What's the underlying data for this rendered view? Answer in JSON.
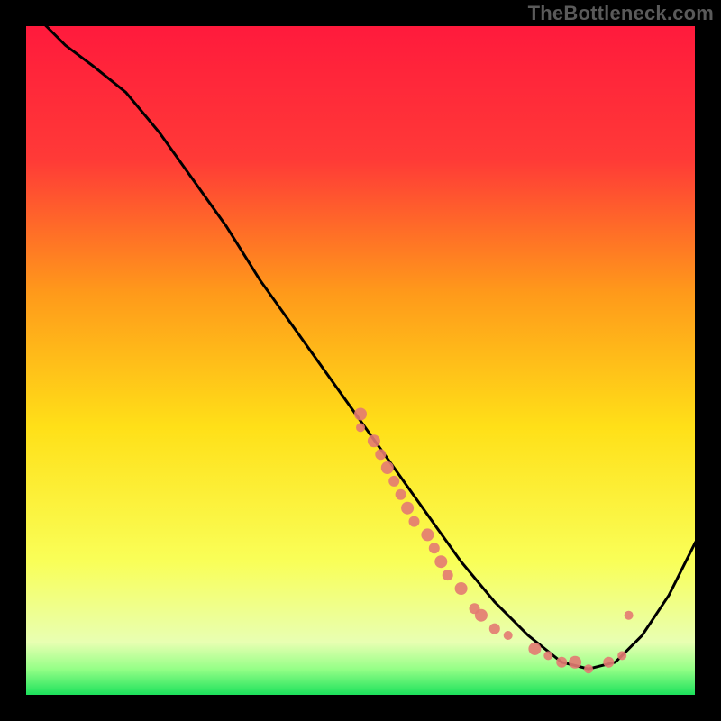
{
  "watermark": "TheBottleneck.com",
  "chart_data": {
    "type": "line",
    "title": "",
    "xlabel": "",
    "ylabel": "",
    "xlim": [
      0,
      100
    ],
    "ylim": [
      0,
      100
    ],
    "background_gradient": {
      "direction": "vertical",
      "stops": [
        {
          "t": 0.0,
          "color": "#ff1a3c"
        },
        {
          "t": 0.2,
          "color": "#ff3a37"
        },
        {
          "t": 0.4,
          "color": "#ff9a1a"
        },
        {
          "t": 0.6,
          "color": "#ffe018"
        },
        {
          "t": 0.8,
          "color": "#f9ff58"
        },
        {
          "t": 0.92,
          "color": "#e8ffb2"
        },
        {
          "t": 0.96,
          "color": "#95ff87"
        },
        {
          "t": 1.0,
          "color": "#18e05a"
        }
      ]
    },
    "series": [
      {
        "name": "bottleneck-curve",
        "type": "line",
        "color": "#000000",
        "width": 3,
        "x": [
          3,
          6,
          10,
          15,
          20,
          25,
          30,
          35,
          40,
          45,
          50,
          55,
          60,
          65,
          70,
          75,
          80,
          84,
          88,
          92,
          96,
          100
        ],
        "y": [
          100,
          97,
          94,
          90,
          84,
          77,
          70,
          62,
          55,
          48,
          41,
          34,
          27,
          20,
          14,
          9,
          5,
          4,
          5,
          9,
          15,
          23
        ]
      },
      {
        "name": "sample-points",
        "type": "scatter",
        "color": "#e37a72",
        "radius_small": 4,
        "radius_large": 7,
        "points": [
          {
            "x": 50,
            "y": 42,
            "r": 7
          },
          {
            "x": 50,
            "y": 40,
            "r": 5
          },
          {
            "x": 52,
            "y": 38,
            "r": 7
          },
          {
            "x": 53,
            "y": 36,
            "r": 6
          },
          {
            "x": 54,
            "y": 34,
            "r": 7
          },
          {
            "x": 55,
            "y": 32,
            "r": 6
          },
          {
            "x": 56,
            "y": 30,
            "r": 6
          },
          {
            "x": 57,
            "y": 28,
            "r": 7
          },
          {
            "x": 58,
            "y": 26,
            "r": 6
          },
          {
            "x": 60,
            "y": 24,
            "r": 7
          },
          {
            "x": 61,
            "y": 22,
            "r": 6
          },
          {
            "x": 62,
            "y": 20,
            "r": 7
          },
          {
            "x": 63,
            "y": 18,
            "r": 6
          },
          {
            "x": 65,
            "y": 16,
            "r": 7
          },
          {
            "x": 67,
            "y": 13,
            "r": 6
          },
          {
            "x": 68,
            "y": 12,
            "r": 7
          },
          {
            "x": 70,
            "y": 10,
            "r": 6
          },
          {
            "x": 72,
            "y": 9,
            "r": 5
          },
          {
            "x": 76,
            "y": 7,
            "r": 7
          },
          {
            "x": 78,
            "y": 6,
            "r": 5
          },
          {
            "x": 80,
            "y": 5,
            "r": 6
          },
          {
            "x": 82,
            "y": 5,
            "r": 7
          },
          {
            "x": 84,
            "y": 4,
            "r": 5
          },
          {
            "x": 87,
            "y": 5,
            "r": 6
          },
          {
            "x": 89,
            "y": 6,
            "r": 5
          },
          {
            "x": 90,
            "y": 12,
            "r": 5
          }
        ]
      }
    ]
  }
}
